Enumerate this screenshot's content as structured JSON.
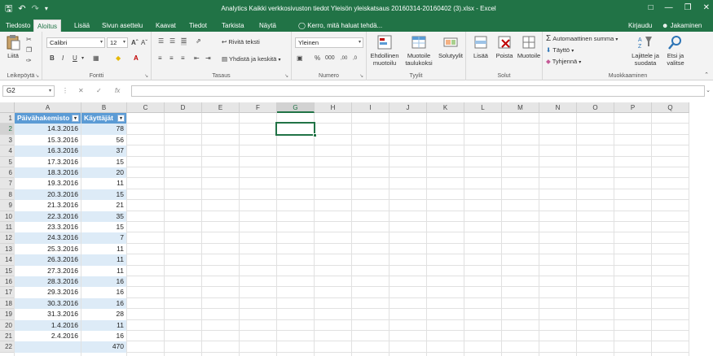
{
  "titlebar": {
    "title": "Analytics Kaikki verkkosivuston tiedot Yleisön yleiskatsaus 20160314-20160402 (3).xlsx - Excel",
    "save_icon": "save-icon",
    "undo_icon": "undo-icon",
    "redo_icon": "redo-icon",
    "qat_more_icon": "chevron-down-icon"
  },
  "tabs": [
    {
      "label": "Tiedosto"
    },
    {
      "label": "Aloitus"
    },
    {
      "label": "Lisää"
    },
    {
      "label": "Sivun asettelu"
    },
    {
      "label": "Kaavat"
    },
    {
      "label": "Tiedot"
    },
    {
      "label": "Tarkista"
    },
    {
      "label": "Näytä"
    }
  ],
  "tellme": "Kerro, mitä haluat tehdä...",
  "account": {
    "signin": "Kirjaudu",
    "share": "Jakaminen"
  },
  "ribbon": {
    "clipboard": {
      "paste": "Liitä",
      "label": "Leikepöytä"
    },
    "font": {
      "name": "Calibri",
      "size": "12",
      "bold": "B",
      "italic": "I",
      "underline": "U",
      "label": "Fontti"
    },
    "alignment": {
      "wrap": "Rivitä teksti",
      "merge": "Yhdistä ja keskitä",
      "label": "Tasaus"
    },
    "number": {
      "format": "Yleinen",
      "label": "Numero"
    },
    "styles": {
      "conditional": "Ehdollinen muotoilu",
      "as_table": "Muotoile taulukoksi",
      "cell_styles": "Solutyylit",
      "label": "Tyylit"
    },
    "cells": {
      "insert": "Lisää",
      "delete": "Poista",
      "format": "Muotoile",
      "label": "Solut"
    },
    "editing": {
      "autosum": "Automaattinen summa",
      "fill": "Täyttö",
      "clear": "Tyhjennä",
      "sort": "Lajittele ja suodata",
      "find": "Etsi ja valitse",
      "label": "Muokkaaminen"
    }
  },
  "formula_bar": {
    "namebox": "G2",
    "fx": "fx",
    "value": ""
  },
  "grid": {
    "columns": [
      "A",
      "B",
      "C",
      "D",
      "E",
      "F",
      "G",
      "H",
      "I",
      "J",
      "K",
      "L",
      "M",
      "N",
      "O",
      "P",
      "Q"
    ],
    "rows": [
      "1",
      "2",
      "3",
      "4",
      "5",
      "6",
      "7",
      "8",
      "9",
      "10",
      "11",
      "12",
      "13",
      "14",
      "15",
      "16",
      "17",
      "18",
      "19",
      "20",
      "21",
      "22"
    ],
    "selected_cell": "G2",
    "table": {
      "headers": [
        "Päivähakemisto",
        "Käyttäjät"
      ],
      "rows": [
        [
          "14.3.2016",
          "78"
        ],
        [
          "15.3.2016",
          "56"
        ],
        [
          "16.3.2016",
          "37"
        ],
        [
          "17.3.2016",
          "15"
        ],
        [
          "18.3.2016",
          "20"
        ],
        [
          "19.3.2016",
          "11"
        ],
        [
          "20.3.2016",
          "15"
        ],
        [
          "21.3.2016",
          "21"
        ],
        [
          "22.3.2016",
          "35"
        ],
        [
          "23.3.2016",
          "15"
        ],
        [
          "24.3.2016",
          "7"
        ],
        [
          "25.3.2016",
          "11"
        ],
        [
          "26.3.2016",
          "11"
        ],
        [
          "27.3.2016",
          "11"
        ],
        [
          "28.3.2016",
          "16"
        ],
        [
          "29.3.2016",
          "16"
        ],
        [
          "30.3.2016",
          "16"
        ],
        [
          "31.3.2016",
          "28"
        ],
        [
          "1.4.2016",
          "11"
        ],
        [
          "2.4.2016",
          "16"
        ]
      ],
      "total": [
        "",
        "470"
      ]
    }
  },
  "colors": {
    "accent": "#217346",
    "table_header": "#5b9bd5",
    "table_band": "#ddebf7"
  }
}
